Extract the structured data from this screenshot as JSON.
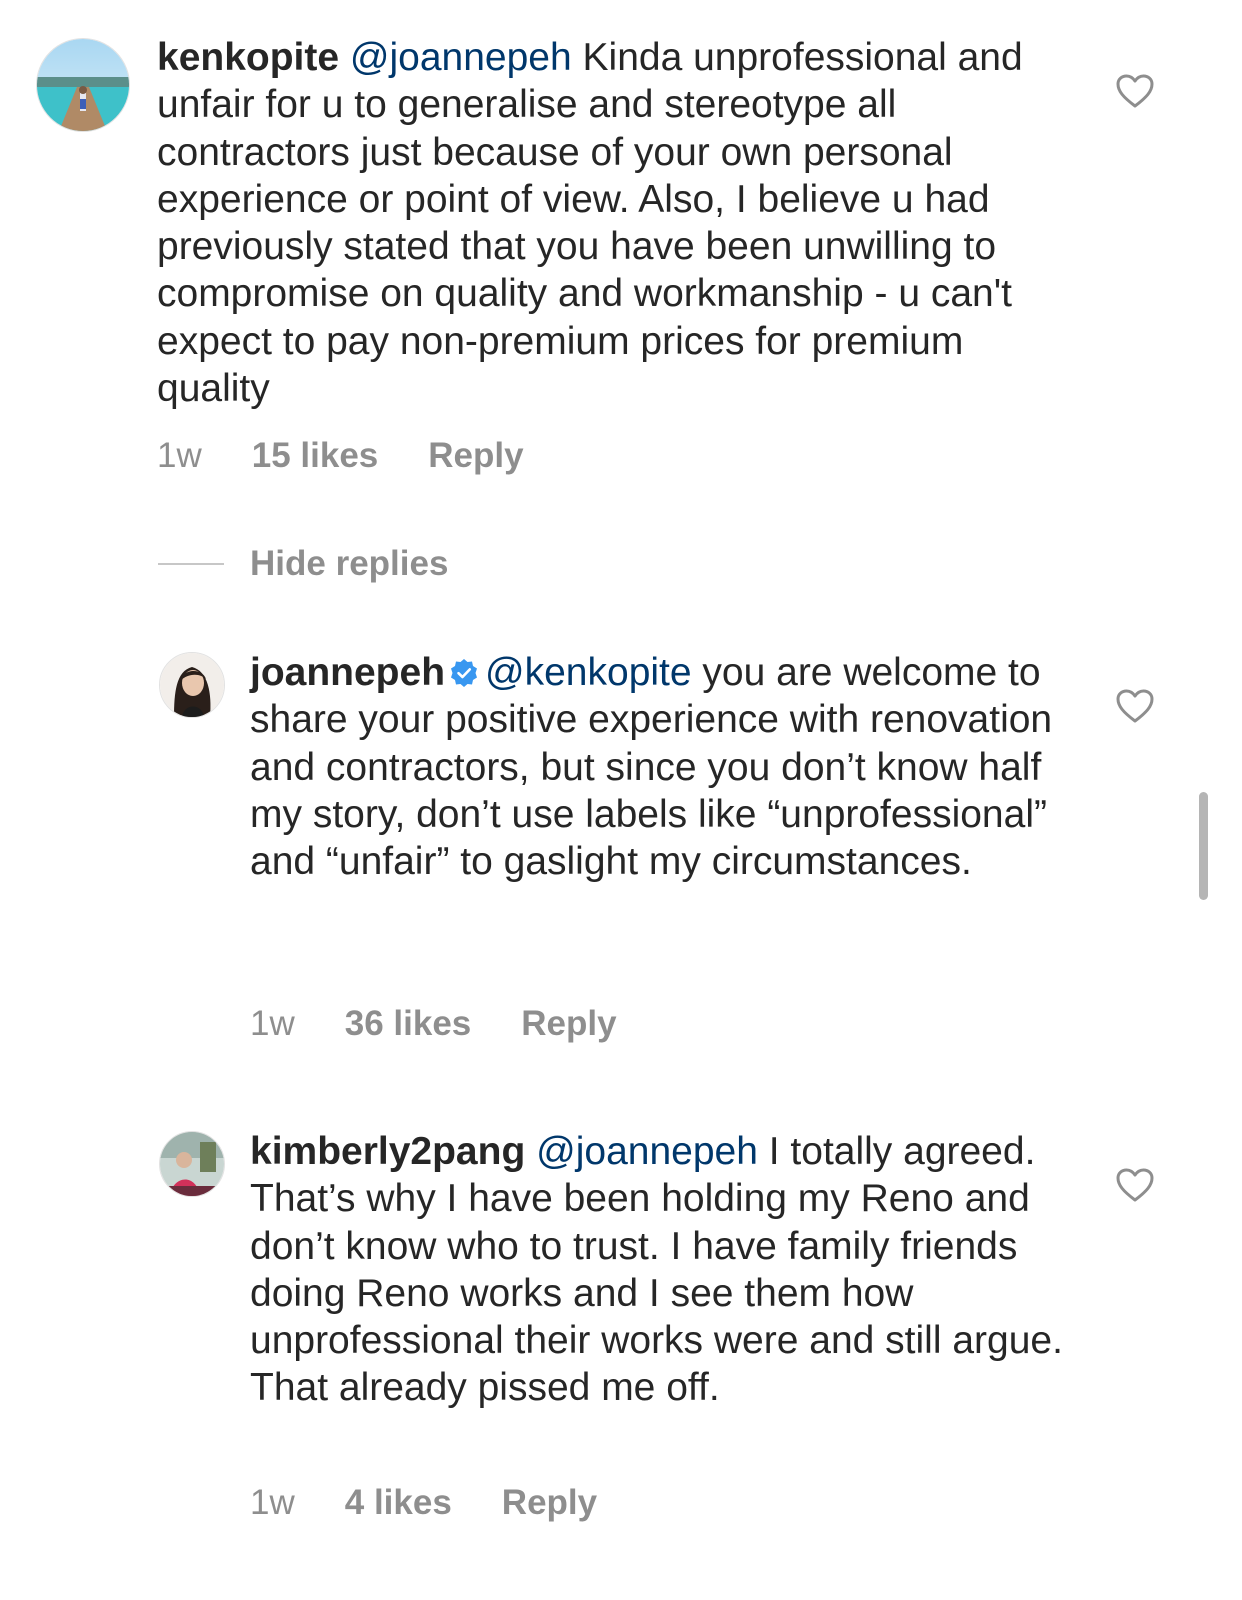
{
  "comments": [
    {
      "username": "kenkopite",
      "mention": "@joannepeh",
      "text": " Kinda unprofessional and unfair for u to generalise and stereotype all contractors just because of your own personal experience or point of view. Also, I believe u had previously stated that you have been unwilling to compromise on quality and workmanship - u can't expect to pay non-premium prices for premium quality",
      "time": "1w",
      "likes": "15 likes",
      "reply": "Reply",
      "verified": false
    },
    {
      "username": "joannepeh",
      "mention": "@kenkopite",
      "text": " you are welcome to share your positive experience with renovation and contractors, but since you don’t know half my story, don’t use labels like “unprofessional” and “unfair” to gaslight my circumstances.",
      "time": "1w",
      "likes": "36 likes",
      "reply": "Reply",
      "verified": true
    },
    {
      "username": "kimberly2pang",
      "mention": "@joannepeh",
      "text": " I totally agreed. That’s why I have been holding my Reno and don’t know who to trust. I have family friends doing Reno works and I see them how unprofessional their works were and still argue. That already pissed me off.",
      "time": "1w",
      "likes": "4 likes",
      "reply": "Reply",
      "verified": false
    }
  ],
  "hide_replies": "Hide replies",
  "colors": {
    "text": "#262626",
    "mention": "#00376b",
    "secondary": "#8e8e8e",
    "verified": "#3897f0"
  },
  "icons": {
    "like": "heart-outline-icon",
    "verified": "verified-badge-icon"
  }
}
